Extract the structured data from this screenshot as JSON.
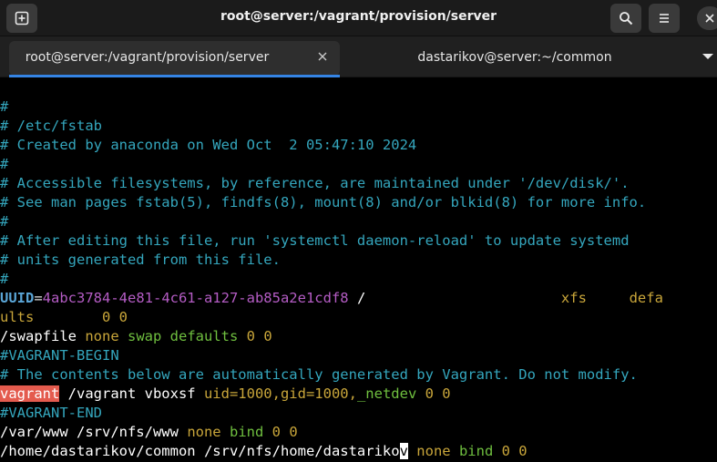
{
  "window": {
    "title": "root@server:/vagrant/provision/server",
    "new_tab_icon": "new-tab-icon",
    "search_icon": "search-icon",
    "menu_icon": "hamburger-menu-icon",
    "close_icon": "close-icon"
  },
  "tabs": [
    {
      "label": "root@server:/vagrant/provision/server",
      "active": true
    },
    {
      "label": "dastarikov@server:~/common",
      "active": false
    }
  ],
  "terminal": {
    "lines": [
      [
        {
          "t": "#",
          "c": "comment"
        }
      ],
      [
        {
          "t": "# /etc/fstab",
          "c": "comment"
        }
      ],
      [
        {
          "t": "# Created by anaconda on Wed Oct  2 05:47:10 2024",
          "c": "comment"
        }
      ],
      [
        {
          "t": "#",
          "c": "comment"
        }
      ],
      [
        {
          "t": "# Accessible filesystems, by reference, are maintained under '/dev/disk/'.",
          "c": "comment"
        }
      ],
      [
        {
          "t": "# See man pages fstab(5), findfs(8), mount(8) and/or blkid(8) for more info.",
          "c": "comment"
        }
      ],
      [
        {
          "t": "#",
          "c": "comment"
        }
      ],
      [
        {
          "t": "# After editing this file, run 'systemctl daemon-reload' to update systemd",
          "c": "comment"
        }
      ],
      [
        {
          "t": "# units generated from this file.",
          "c": "comment"
        }
      ],
      [
        {
          "t": "#",
          "c": "comment"
        }
      ],
      [
        {
          "t": "UUID",
          "c": "key"
        },
        {
          "t": "=",
          "c": "eq"
        },
        {
          "t": "4abc3784-4e81-4c61-a127-ab85a2e1cdf8",
          "c": "uuid"
        },
        {
          "t": " /                       xfs     defa",
          "c": "mix1"
        }
      ],
      [
        {
          "t": "ults",
          "c": "y"
        },
        {
          "t": "        ",
          "c": "w"
        },
        {
          "t": "0 0",
          "c": "y"
        }
      ],
      [
        {
          "t": "/swapfile ",
          "c": "w"
        },
        {
          "t": "none",
          "c": "y"
        },
        {
          "t": " ",
          "c": "w"
        },
        {
          "t": "swap defaults",
          "c": "g"
        },
        {
          "t": " ",
          "c": "w"
        },
        {
          "t": "0 0",
          "c": "y"
        }
      ],
      [
        {
          "t": "#VAGRANT-BEGIN",
          "c": "comment"
        }
      ],
      [
        {
          "t": "# The contents below are automatically generated by Vagrant. Do not modify.",
          "c": "comment"
        }
      ],
      [
        {
          "t": "vagrant",
          "c": "hl"
        },
        {
          "t": " /vagrant vboxsf ",
          "c": "w"
        },
        {
          "t": "uid=1000,gid=1000,",
          "c": "y"
        },
        {
          "t": "_netdev",
          "c": "g"
        },
        {
          "t": " ",
          "c": "w"
        },
        {
          "t": "0 0",
          "c": "y"
        }
      ],
      [
        {
          "t": "#VAGRANT-END",
          "c": "comment"
        }
      ],
      [
        {
          "t": "/var/www /srv/nfs/www ",
          "c": "w"
        },
        {
          "t": "none",
          "c": "y"
        },
        {
          "t": " ",
          "c": "w"
        },
        {
          "t": "bind",
          "c": "g"
        },
        {
          "t": " ",
          "c": "w"
        },
        {
          "t": "0 0",
          "c": "y"
        }
      ],
      [
        {
          "t": "/home/dastarikov/common /srv/nfs/home/dastariko",
          "c": "w"
        },
        {
          "t": "v",
          "c": "cursor"
        },
        {
          "t": " ",
          "c": "w"
        },
        {
          "t": "none",
          "c": "y"
        },
        {
          "t": " ",
          "c": "w"
        },
        {
          "t": "bind",
          "c": "g"
        },
        {
          "t": " ",
          "c": "w"
        },
        {
          "t": "0 0",
          "c": "y"
        }
      ]
    ]
  },
  "colors": {
    "comment": "#34a6bd",
    "key": "#5aa5d6",
    "uuid": "#b45cc4",
    "yellow": "#c9a63a",
    "green": "#6fbf3f",
    "highlight": "#e45b4e",
    "tab_accent": "#3584e4"
  }
}
